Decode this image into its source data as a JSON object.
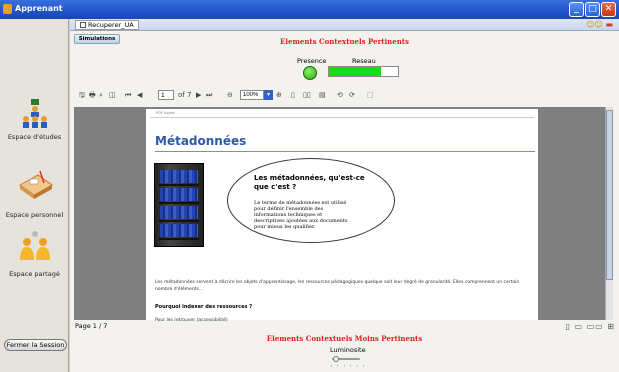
{
  "window": {
    "title": "Apprenant"
  },
  "sidebar": {
    "items": [
      {
        "label": "Espace d'études",
        "icon": "students-icon"
      },
      {
        "label": "Espace personnel",
        "icon": "desk-icon"
      },
      {
        "label": "Espace partagé",
        "icon": "shared-users-icon"
      }
    ],
    "logout_label": "Fermer la Session"
  },
  "main": {
    "tab_label": "Recuperer_UA",
    "subtab_label": "Simulations",
    "pertinent_title": "Elements Contextuels Pertinents",
    "presence_label": "Presence",
    "reseau_label": "Reseau",
    "reseau_level": 0.75,
    "less_pertinent_title": "Elements Contextuels Moins Pertinents",
    "luminosite_label": "Luminosite",
    "luminosite_level": 0.05
  },
  "toolbar": {
    "page_value": "1",
    "page_total": "of 7",
    "zoom_value": "100%"
  },
  "document": {
    "header": "PDF Sujets",
    "title": "Métadonnées",
    "question": "Les métadonnées, qu'est-ce que c'est ?",
    "definition": "Le terme de métadonnées est utilisé pour définir l'ensemble des informations techniques et descriptives ajoutées aux documents pour mieux les qualifier.",
    "paragraph": "Les métadonnées servent à décrire les objets d'apprentissage, les ressources pédagogiques quelque soit leur degré de granularité. Elles comprennent un certain nombre d'éléments...",
    "subheading": "Pourquoi indexer des ressources ?",
    "bullet": "Pour les retrouver (accessibilité)"
  },
  "pagebar": {
    "page_count": "Page 1 / 7"
  }
}
